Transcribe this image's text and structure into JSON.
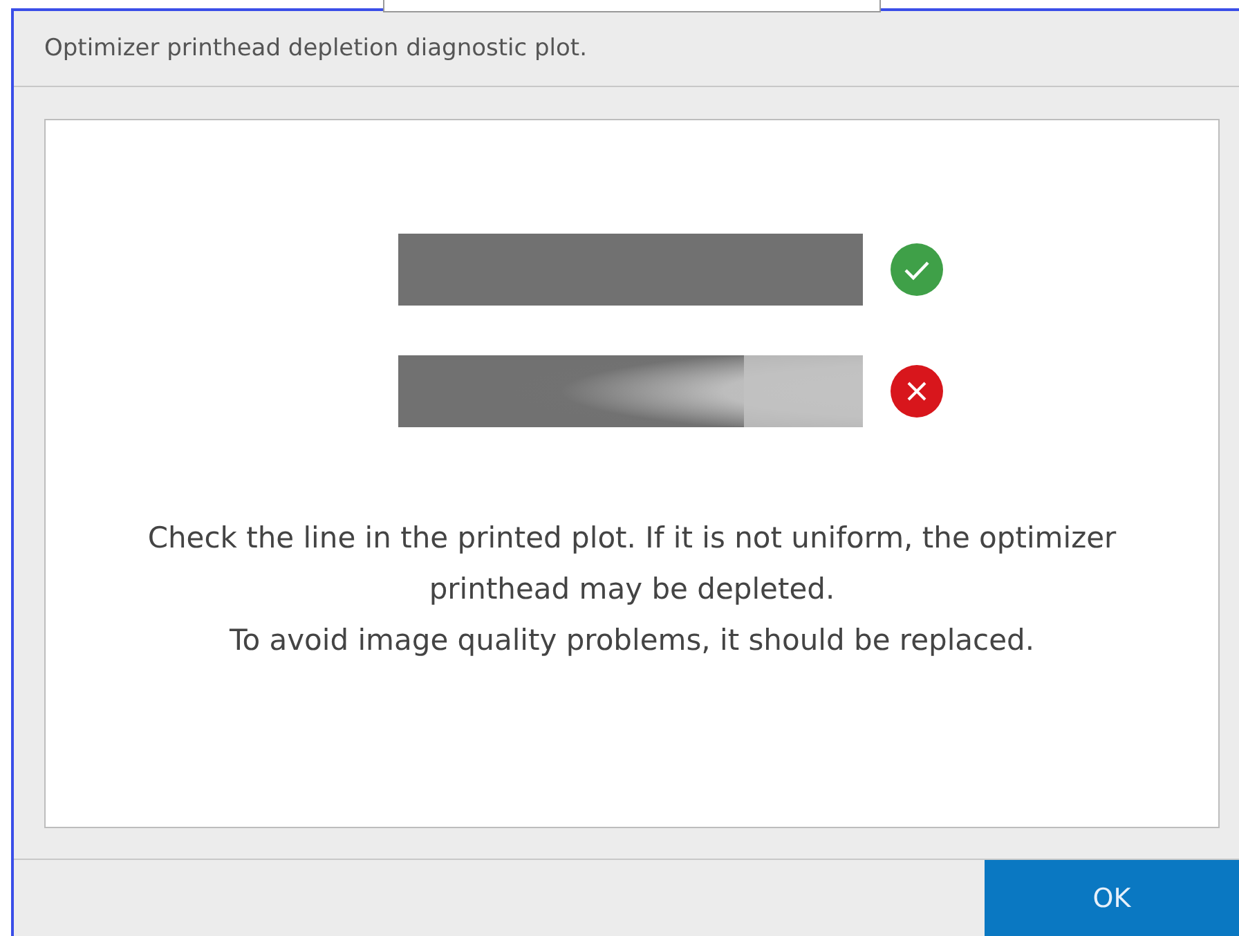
{
  "dialog": {
    "title": "Optimizer printhead depletion diagnostic plot."
  },
  "samples": [
    {
      "kind": "uniform"
    },
    {
      "kind": "depleted"
    }
  ],
  "message": [
    "Check the line in the printed plot. If it is not uniform, the optimizer printhead may be depleted.",
    "To avoid image quality problems, it should be replaced."
  ],
  "buttons": [
    "OK"
  ]
}
